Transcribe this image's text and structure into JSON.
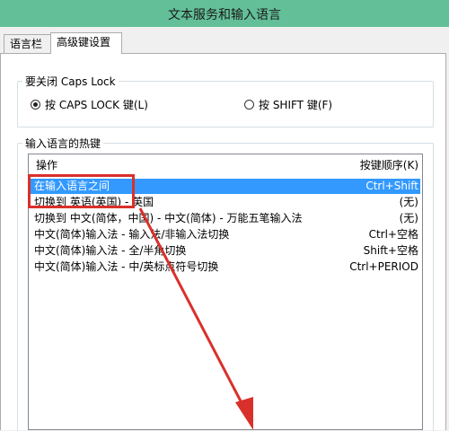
{
  "window": {
    "title": "文本服务和输入语言"
  },
  "tabs": [
    {
      "label": "语言栏"
    },
    {
      "label": "高级键设置"
    }
  ],
  "caps_group": {
    "label": "要关闭 Caps Lock",
    "options": [
      {
        "label": "按 CAPS LOCK 键(L)",
        "checked": true
      },
      {
        "label": "按 SHIFT 键(F)",
        "checked": false
      }
    ]
  },
  "hotkeys_group": {
    "label": "输入语言的热键",
    "columns": {
      "operation": "操作",
      "key_sequence": "按键顺序(K)"
    },
    "rows": [
      {
        "operation": "在输入语言之间",
        "keys": "Ctrl+Shift"
      },
      {
        "operation": "切换到 英语(英国) - 英国",
        "keys": "(无)"
      },
      {
        "operation": "切换到 中文(简体，中国) - 中文(简体) - 万能五笔输入法",
        "keys": "(无)"
      },
      {
        "operation": "中文(简体)输入法 - 输入法/非输入法切换",
        "keys": "Ctrl+空格"
      },
      {
        "operation": "中文(简体)输入法 - 全/半角切换",
        "keys": "Shift+空格"
      },
      {
        "operation": "中文(简体)输入法 - 中/英标点符号切换",
        "keys": "Ctrl+PERIOD"
      }
    ]
  },
  "colors": {
    "titlebar": "#63bf98",
    "selection": "#3399ff",
    "annotation": "#d9302b"
  }
}
